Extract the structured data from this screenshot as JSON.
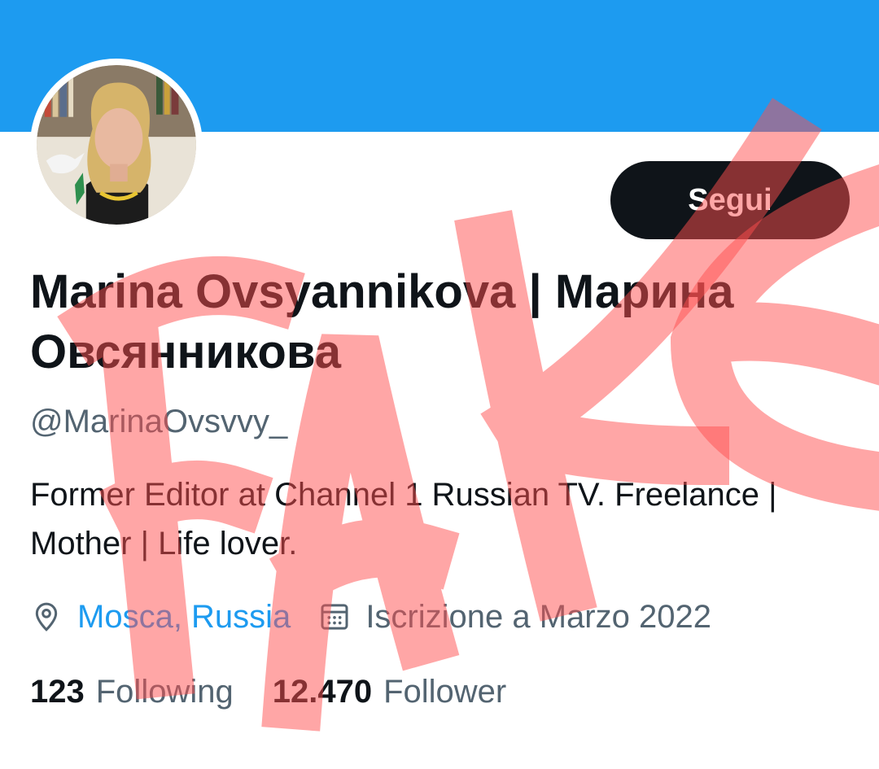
{
  "profile": {
    "display_name": "Marina Ovsyannikova | Марина Овсянникова",
    "handle": "@MarinaOvsvvy_",
    "bio": "Former Editor at Channel 1 Russian TV. Freelance | Mother | Life lover.",
    "location": "Mosca, Russia",
    "joined": "Iscrizione a Marzo 2022"
  },
  "actions": {
    "follow_label": "Segui"
  },
  "stats": {
    "following_count": "123",
    "following_label": "Following",
    "followers_count": "12.470",
    "followers_label": "Follower"
  },
  "overlay": {
    "stamp_text": "FAKE"
  },
  "icons": {
    "location": "location-pin-icon",
    "calendar": "calendar-icon"
  },
  "colors": {
    "banner": "#1d9bf0",
    "button": "#0f1419",
    "link": "#1d9bf0",
    "stamp": "#ff4d4d"
  }
}
